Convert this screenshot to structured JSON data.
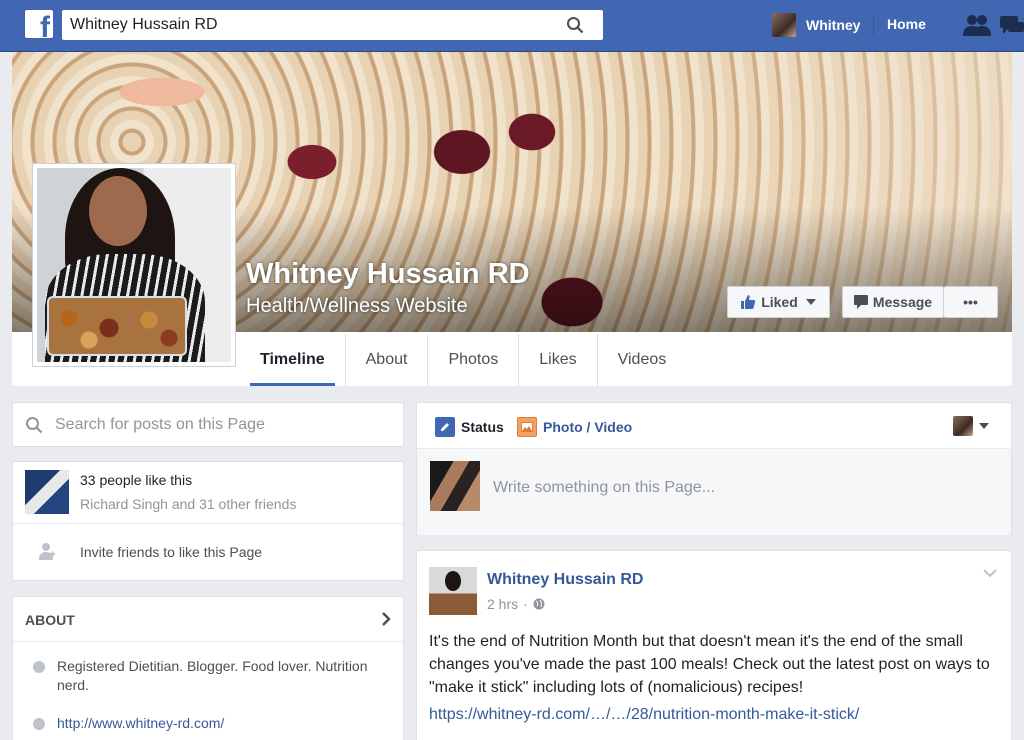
{
  "topbar": {
    "logo": "f",
    "search_value": "Whitney Hussain RD",
    "user_name": "Whitney",
    "home_label": "Home",
    "icons": [
      "facebook-logo-icon",
      "search-icon",
      "friend-requests-icon",
      "messages-icon"
    ]
  },
  "page": {
    "name": "Whitney Hussain RD",
    "category": "Health/Wellness Website",
    "liked_label": "Liked",
    "message_label": "Message",
    "more_label": "•••"
  },
  "tabs": [
    "Timeline",
    "About",
    "Photos",
    "Likes",
    "Videos"
  ],
  "active_tab": "Timeline",
  "sidebar": {
    "search_placeholder": "Search for posts on this Page",
    "likes_count": "33 people like this",
    "likes_friends": "Richard Singh and 31 other friends",
    "invite_label": "Invite friends to like this Page",
    "about_heading": "ABOUT",
    "about_description": "Registered Dietitian. Blogger. Food lover. Nutrition nerd.",
    "about_website": "http://www.whitney-rd.com/"
  },
  "composer": {
    "status_label": "Status",
    "photo_video_label": "Photo / Video",
    "placeholder": "Write something on this Page..."
  },
  "post": {
    "author": "Whitney Hussain RD",
    "time": "2 hrs",
    "text": "It's the end of Nutrition Month but that doesn't mean it's the end of the small changes you've made the past 100 meals! Check out the latest post on ways to \"make it stick\" including lots of (nomalicious) recipes!",
    "link": "https://whitney-rd.com/…/…/28/nutrition-month-make-it-stick/"
  },
  "colors": {
    "brand_blue": "#4267b2",
    "link_blue": "#365899",
    "background": "#e9ebee"
  }
}
